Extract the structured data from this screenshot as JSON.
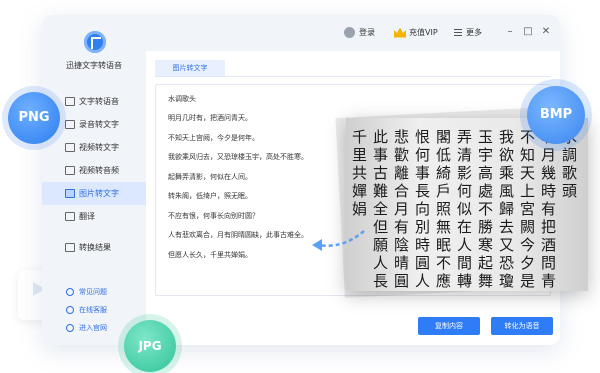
{
  "app": {
    "name": "迅捷文字转语音"
  },
  "nav": [
    {
      "label": "文字转语音",
      "icon": "text-to-speech-icon"
    },
    {
      "label": "录音转文字",
      "icon": "recording-icon"
    },
    {
      "label": "视频转文字",
      "icon": "video-icon"
    },
    {
      "label": "视频转音频",
      "icon": "video-audio-icon"
    },
    {
      "label": "图片转文字",
      "icon": "image-icon",
      "active": true
    },
    {
      "label": "翻译",
      "icon": "translate-icon"
    }
  ],
  "nav_results": {
    "label": "转换结果"
  },
  "help": [
    {
      "label": "常见问题"
    },
    {
      "label": "在线客服"
    },
    {
      "label": "进入官网"
    }
  ],
  "topbar": {
    "login": "登录",
    "vip": "充值VIP",
    "more": "更多",
    "minimize": "–",
    "maximize": "□",
    "close": "✕"
  },
  "tab": {
    "label": "图片转文字"
  },
  "result_text": [
    "水调歌头",
    "明月几时有，把酒问青天。",
    "不知天上宫阙，今夕是何年。",
    "我欲乘风归去，又恐琼楼玉宇，高处不胜寒。",
    "起舞弄清影，何似在人间。",
    "转朱阁，低绮户，照无眠。",
    "不应有恨，何事长向别时圆？",
    "人有悲欢离合，月有阴晴圆缺，此事古难全。",
    "但愿人长久，千里共婵娟。"
  ],
  "buttons": {
    "copy": "复制内容",
    "convert": "转化为语音"
  },
  "photo_columns": [
    "水調歌頭",
    "明月幾時有把酒問青天",
    "不知天上宮闕今夕是何年",
    "我欲乘風歸去又恐瓊樓",
    "玉宇高處不勝寒起舞",
    "弄清影何似在人間轉朱",
    "閣低綺戶照無眠不應有",
    "恨何事長向別時圓人有",
    "悲歡離合月有陰晴圓缺",
    "此事古難全但願人長久",
    "千里共嬋娟"
  ],
  "badges": {
    "png": "PNG",
    "bmp": "BMP",
    "jpg": "JPG"
  },
  "colors": {
    "accent": "#2f7df6",
    "active_bg": "#dbe8ff",
    "png": "#2c7df0",
    "jpg": "#30c49a"
  }
}
